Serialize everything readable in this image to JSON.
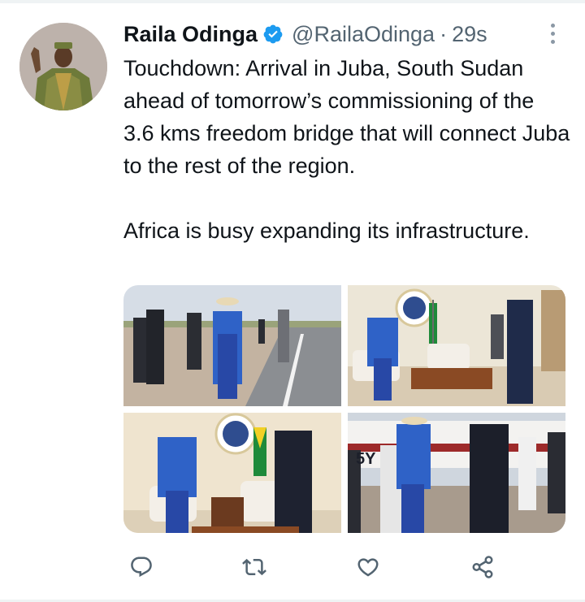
{
  "tweet": {
    "author": {
      "name": "Raila Odinga",
      "handle": "@RailaOdinga",
      "verified": true
    },
    "time": "29s",
    "separator": "·",
    "paragraphs": [
      "Touchdown: Arrival in Juba, South Sudan ahead of tomorrow’s commissioning of the 3.6 kms freedom bridge that will connect Juba to the rest of the region.",
      "Africa is busy expanding its infrastructure."
    ],
    "media": {
      "photos": [
        {
          "plate_text": ""
        },
        {
          "plate_text": ""
        },
        {
          "plate_text": ""
        },
        {
          "plate_text": "5Y"
        }
      ]
    }
  },
  "icons": {
    "verified": "verified-badge-icon",
    "more": "more-vertical-icon",
    "reply": "reply-icon",
    "retweet": "retweet-icon",
    "like": "like-heart-icon",
    "share": "share-icon"
  },
  "colors": {
    "verified_blue": "#1d9bf0",
    "text": "#0f1419",
    "secondary": "#536471",
    "icon": "#536471"
  }
}
